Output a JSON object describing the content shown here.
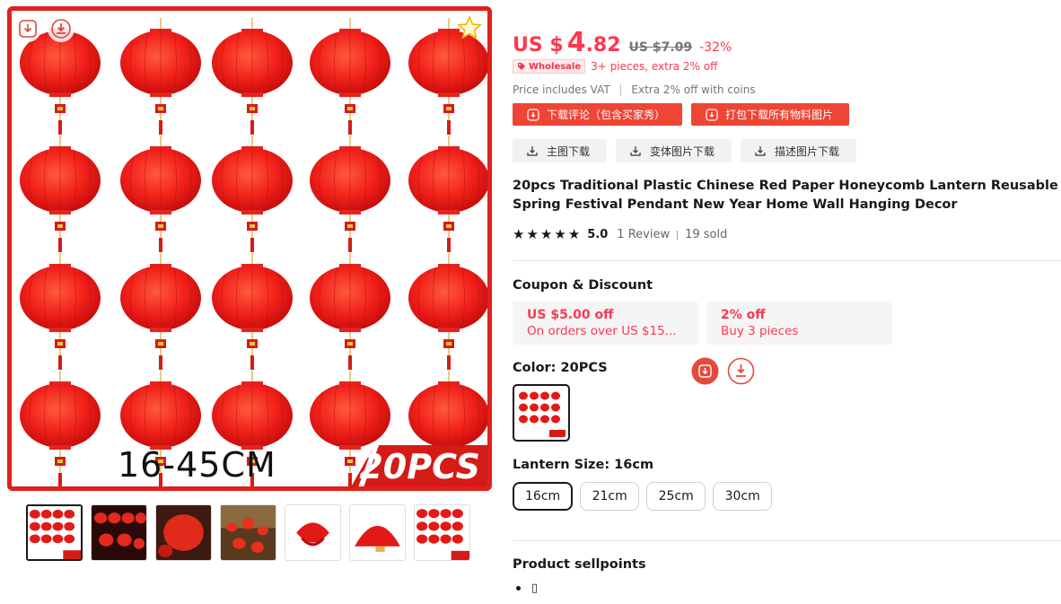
{
  "gallery": {
    "caption": "16-45CM",
    "badge": "20PCS",
    "icons": {
      "save": "save-image-icon",
      "download": "download-icon",
      "favorite": "star-outline-icon"
    },
    "thumbnails": [
      {
        "name": "thumb-lantern-grid",
        "active": true
      },
      {
        "name": "thumb-hanging-lanterns"
      },
      {
        "name": "thumb-lantern-closeup"
      },
      {
        "name": "thumb-tree-lanterns"
      },
      {
        "name": "thumb-lantern-folded"
      },
      {
        "name": "thumb-lantern-fan"
      },
      {
        "name": "thumb-lantern-grid-2"
      }
    ],
    "colors": {
      "frame": "#e0201b",
      "lantern": "#e21a16",
      "badge": "#d51b16"
    }
  },
  "price": {
    "currency": "US $",
    "integer": "4",
    "decimal": ".82",
    "original": "US $7.09",
    "discount": "-32%"
  },
  "wholesale": {
    "badge": "Wholesale",
    "text": "3+ pieces, extra 2% off"
  },
  "vat_text": "Price includes VAT",
  "coins_text": "Extra 2% off with coins",
  "downloads": {
    "reviews_button": "下载评论（包含买家秀）",
    "pack_button": "打包下载所有物料图片",
    "main_image_button": "主图下载",
    "variant_image_button": "变体图片下载",
    "description_image_button": "描述图片下载"
  },
  "product": {
    "title": "20pcs Traditional Plastic Chinese Red Paper Honeycomb Lantern Reusable Spring Festival Pendant New Year Home Wall Hanging Decor",
    "rating": "5.0",
    "stars": 5,
    "reviews": "1 Review",
    "sold": "19 sold"
  },
  "coupons": {
    "title": "Coupon & Discount",
    "items": [
      {
        "main": "US $5.00 off",
        "sub": "On orders over US $15..."
      },
      {
        "main": "2% off",
        "sub": "Buy 3 pieces"
      }
    ]
  },
  "color": {
    "label": "Color: 20PCS",
    "selected": "20PCS"
  },
  "size": {
    "label": "Lantern Size: 16cm",
    "options": [
      "16cm",
      "21cm",
      "25cm",
      "30cm"
    ],
    "selected": "16cm"
  },
  "sellpoints": {
    "title": "Product sellpoints",
    "items": [
      "▯"
    ]
  },
  "theme": {
    "accent": "#fd384f",
    "download_red": "#ee4535"
  }
}
